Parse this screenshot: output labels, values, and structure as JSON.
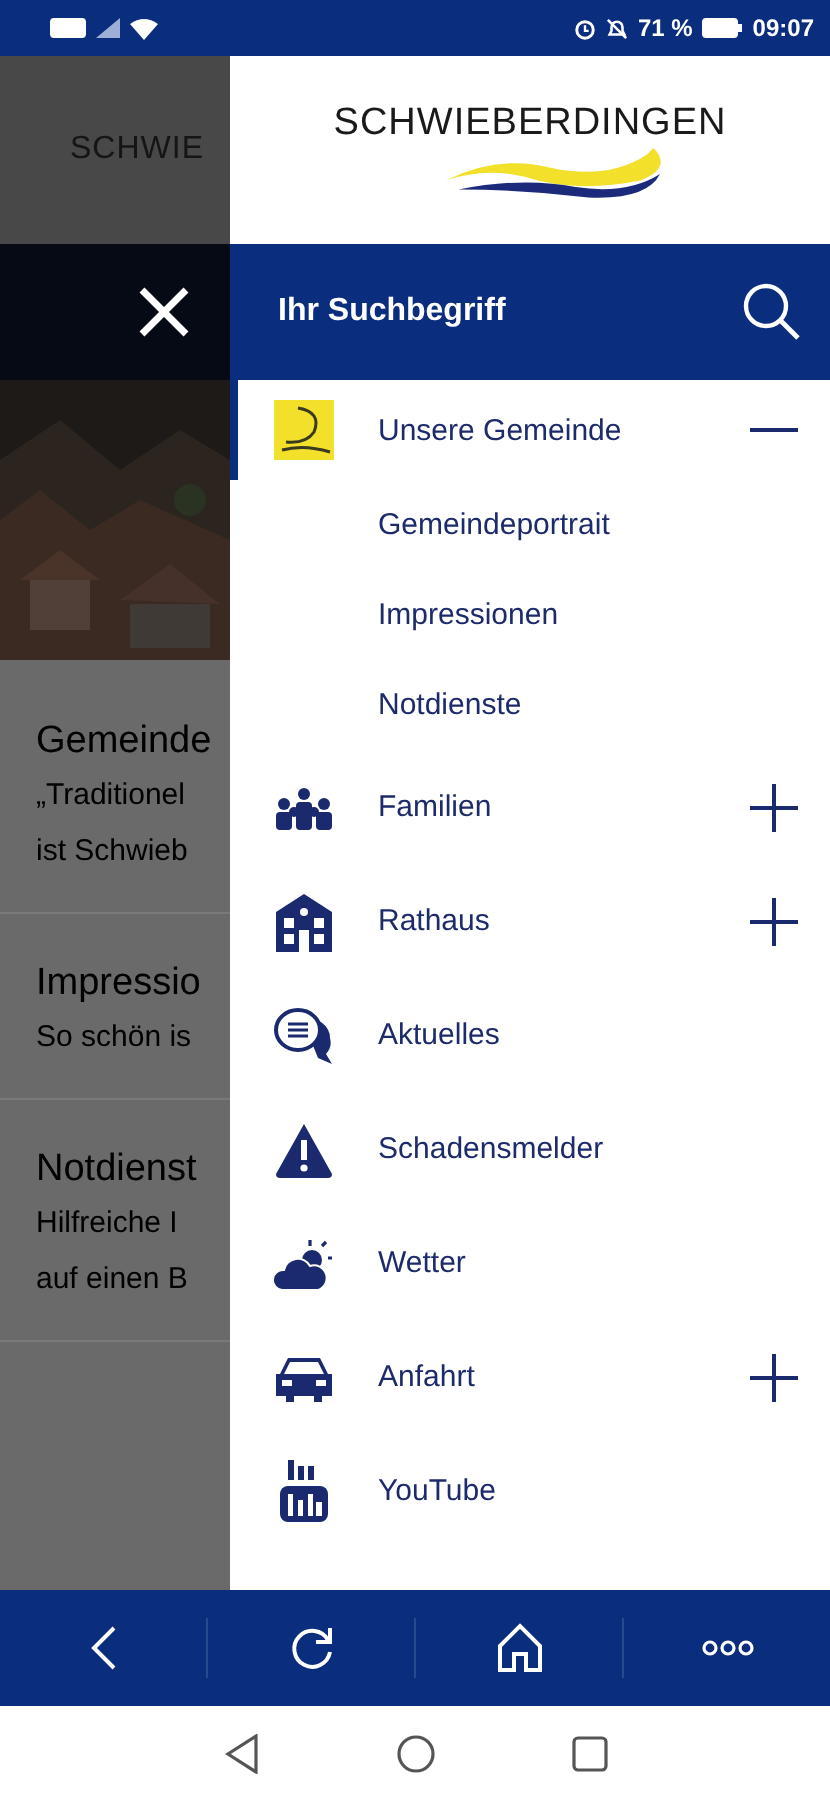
{
  "status_bar": {
    "battery": "71 %",
    "time": "09:07"
  },
  "background_page": {
    "header_title": "SCHWIE",
    "articles": [
      {
        "title": "Gemeinde",
        "lines": [
          "„Traditionel",
          "ist Schwieb"
        ]
      },
      {
        "title": "Impressio",
        "lines": [
          "So schön is"
        ]
      },
      {
        "title": "Notdienst",
        "lines": [
          "Hilfreiche I",
          "auf einen B"
        ]
      }
    ]
  },
  "drawer": {
    "logo": "SCHWIEBERDINGEN",
    "search": {
      "placeholder": "Ihr Suchbegriff"
    },
    "items": [
      {
        "label": "Unsere Gemeinde",
        "kind": "emblem",
        "selected": true,
        "expanded": true,
        "children": [
          {
            "label": "Gemeindeportrait"
          },
          {
            "label": "Impressionen"
          },
          {
            "label": "Notdienste"
          }
        ]
      },
      {
        "label": "Familien",
        "kind": "family",
        "selected": false,
        "expanded": false
      },
      {
        "label": "Rathaus",
        "kind": "townhall",
        "selected": false,
        "expanded": false
      },
      {
        "label": "Aktuelles",
        "kind": "news",
        "selected": false
      },
      {
        "label": "Schadensmelder",
        "kind": "warning",
        "selected": false
      },
      {
        "label": "Wetter",
        "kind": "weather",
        "selected": false
      },
      {
        "label": "Anfahrt",
        "kind": "car",
        "selected": false,
        "expanded": false
      },
      {
        "label": "YouTube",
        "kind": "video",
        "selected": false
      }
    ]
  }
}
